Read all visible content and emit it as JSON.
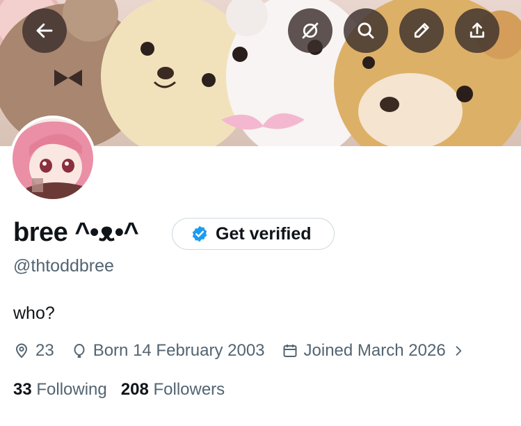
{
  "profile": {
    "display_name": "bree ^•ᴥ•^",
    "handle": "@thtoddbree",
    "bio": "who?",
    "verify_label": "Get verified",
    "location": "23",
    "birthday": "Born 14 February 2003",
    "joined": "Joined March 2026",
    "following_count": "33",
    "following_label": "Following",
    "followers_count": "208",
    "followers_label": "Followers"
  },
  "header_actions": [
    "back-icon",
    "grok-icon",
    "search-icon",
    "edit-icon",
    "share-icon"
  ],
  "colors": {
    "accent": "#1d9bf0",
    "secondary_text": "#536471",
    "button_overlay": "#3c302c"
  }
}
